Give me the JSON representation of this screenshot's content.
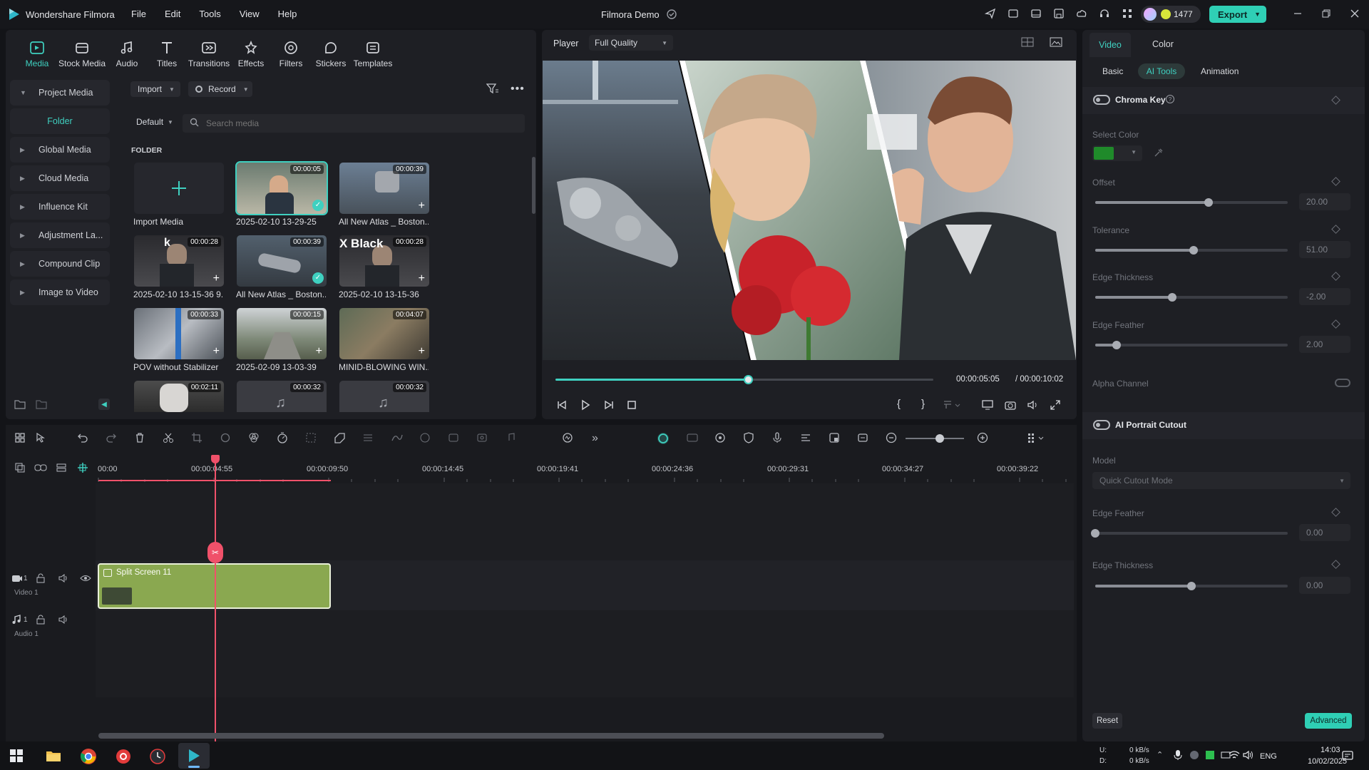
{
  "app": {
    "name": "Wondershare Filmora",
    "menu": [
      "File",
      "Edit",
      "Tools",
      "View",
      "Help"
    ],
    "project_title": "Filmora Demo",
    "credits": "1477",
    "export_label": "Export"
  },
  "toolbar": {
    "items": [
      "Media",
      "Stock Media",
      "Audio",
      "Titles",
      "Transitions",
      "Effects",
      "Filters",
      "Stickers",
      "Templates"
    ]
  },
  "sidebar": {
    "items": [
      {
        "label": "Project Media"
      },
      {
        "label": "Folder"
      },
      {
        "label": "Global Media"
      },
      {
        "label": "Cloud Media"
      },
      {
        "label": "Influence Kit"
      },
      {
        "label": "Adjustment La..."
      },
      {
        "label": "Compound Clip"
      },
      {
        "label": "Image to Video"
      }
    ]
  },
  "media": {
    "import_label": "Import",
    "record_label": "Record",
    "sort_label": "Default",
    "search_placeholder": "Search media",
    "folder_heading": "FOLDER",
    "import_media_label": "Import Media",
    "clips": [
      {
        "label": "2025-02-10 13-29-25",
        "duration": "00:00:05"
      },
      {
        "label": "All New Atlas _ Boston...",
        "duration": "00:00:39"
      },
      {
        "label": "2025-02-10 13-15-36 9...",
        "duration": "00:00:28"
      },
      {
        "label": "All New Atlas _ Boston...",
        "duration": "00:00:39"
      },
      {
        "label": "2025-02-10 13-15-36",
        "duration": "00:00:28"
      },
      {
        "label": "POV without Stabilizer",
        "duration": "00:00:33"
      },
      {
        "label": "2025-02-09 13-03-39",
        "duration": "00:00:15"
      },
      {
        "label": "MINID-BLOWING WIN...",
        "duration": "00:04:07"
      },
      {
        "label": "",
        "duration": "00:02:11"
      },
      {
        "label": "",
        "duration": "00:00:32"
      },
      {
        "label": "",
        "duration": "00:00:32"
      }
    ],
    "overlay_text_1": "k",
    "overlay_text_2": "X Black"
  },
  "player": {
    "label": "Player",
    "quality": "Full Quality",
    "current_time": "00:00:05:05",
    "total_time": "/ 00:00:10:02",
    "progress": 0.51
  },
  "timeline": {
    "ticks": [
      "00:00",
      "00:00:04:55",
      "00:00:09:50",
      "00:00:14:45",
      "00:00:19:41",
      "00:00:24:36",
      "00:00:29:31",
      "00:00:34:27",
      "00:00:39:22"
    ],
    "clip_label": "Split Screen 11",
    "video_track": "Video 1",
    "audio_track": "Audio 1",
    "track_num_video": "1",
    "track_num_audio": "1"
  },
  "props": {
    "tabs": [
      "Video",
      "Color"
    ],
    "subtabs": [
      "Basic",
      "AI Tools",
      "Animation"
    ],
    "chroma_key": "Chroma Key",
    "select_color": "Select Color",
    "chroma_color": "#1f8a2a",
    "offset": {
      "label": "Offset",
      "value": "20.00",
      "level": 0.59
    },
    "tolerance": {
      "label": "Tolerance",
      "value": "51.00",
      "level": 0.51
    },
    "edge_thickness": {
      "label": "Edge Thickness",
      "value": "-2.00",
      "level": 0.4
    },
    "edge_feather": {
      "label": "Edge Feather",
      "value": "2.00",
      "level": 0.11
    },
    "alpha_channel": "Alpha Channel",
    "ai_portrait": "AI Portrait Cutout",
    "model_label": "Model",
    "model_value": "Quick Cutout Mode",
    "edge_feather2": {
      "label": "Edge Feather",
      "value": "0.00",
      "level": 0.0
    },
    "edge_thickness2": {
      "label": "Edge Thickness",
      "value": "0.00",
      "level": 0.5
    },
    "reset": "Reset",
    "advanced": "Advanced"
  },
  "taskbar": {
    "net_up": "0 kB/s",
    "net_down": "0 kB/s",
    "net_u": "U:",
    "net_d": "D:",
    "lang": "ENG",
    "time": "14:03",
    "date": "10/02/2025"
  },
  "colors": {
    "accent": "#3fd0c0",
    "clip": "#8aa850",
    "playhead": "#f0516a"
  }
}
